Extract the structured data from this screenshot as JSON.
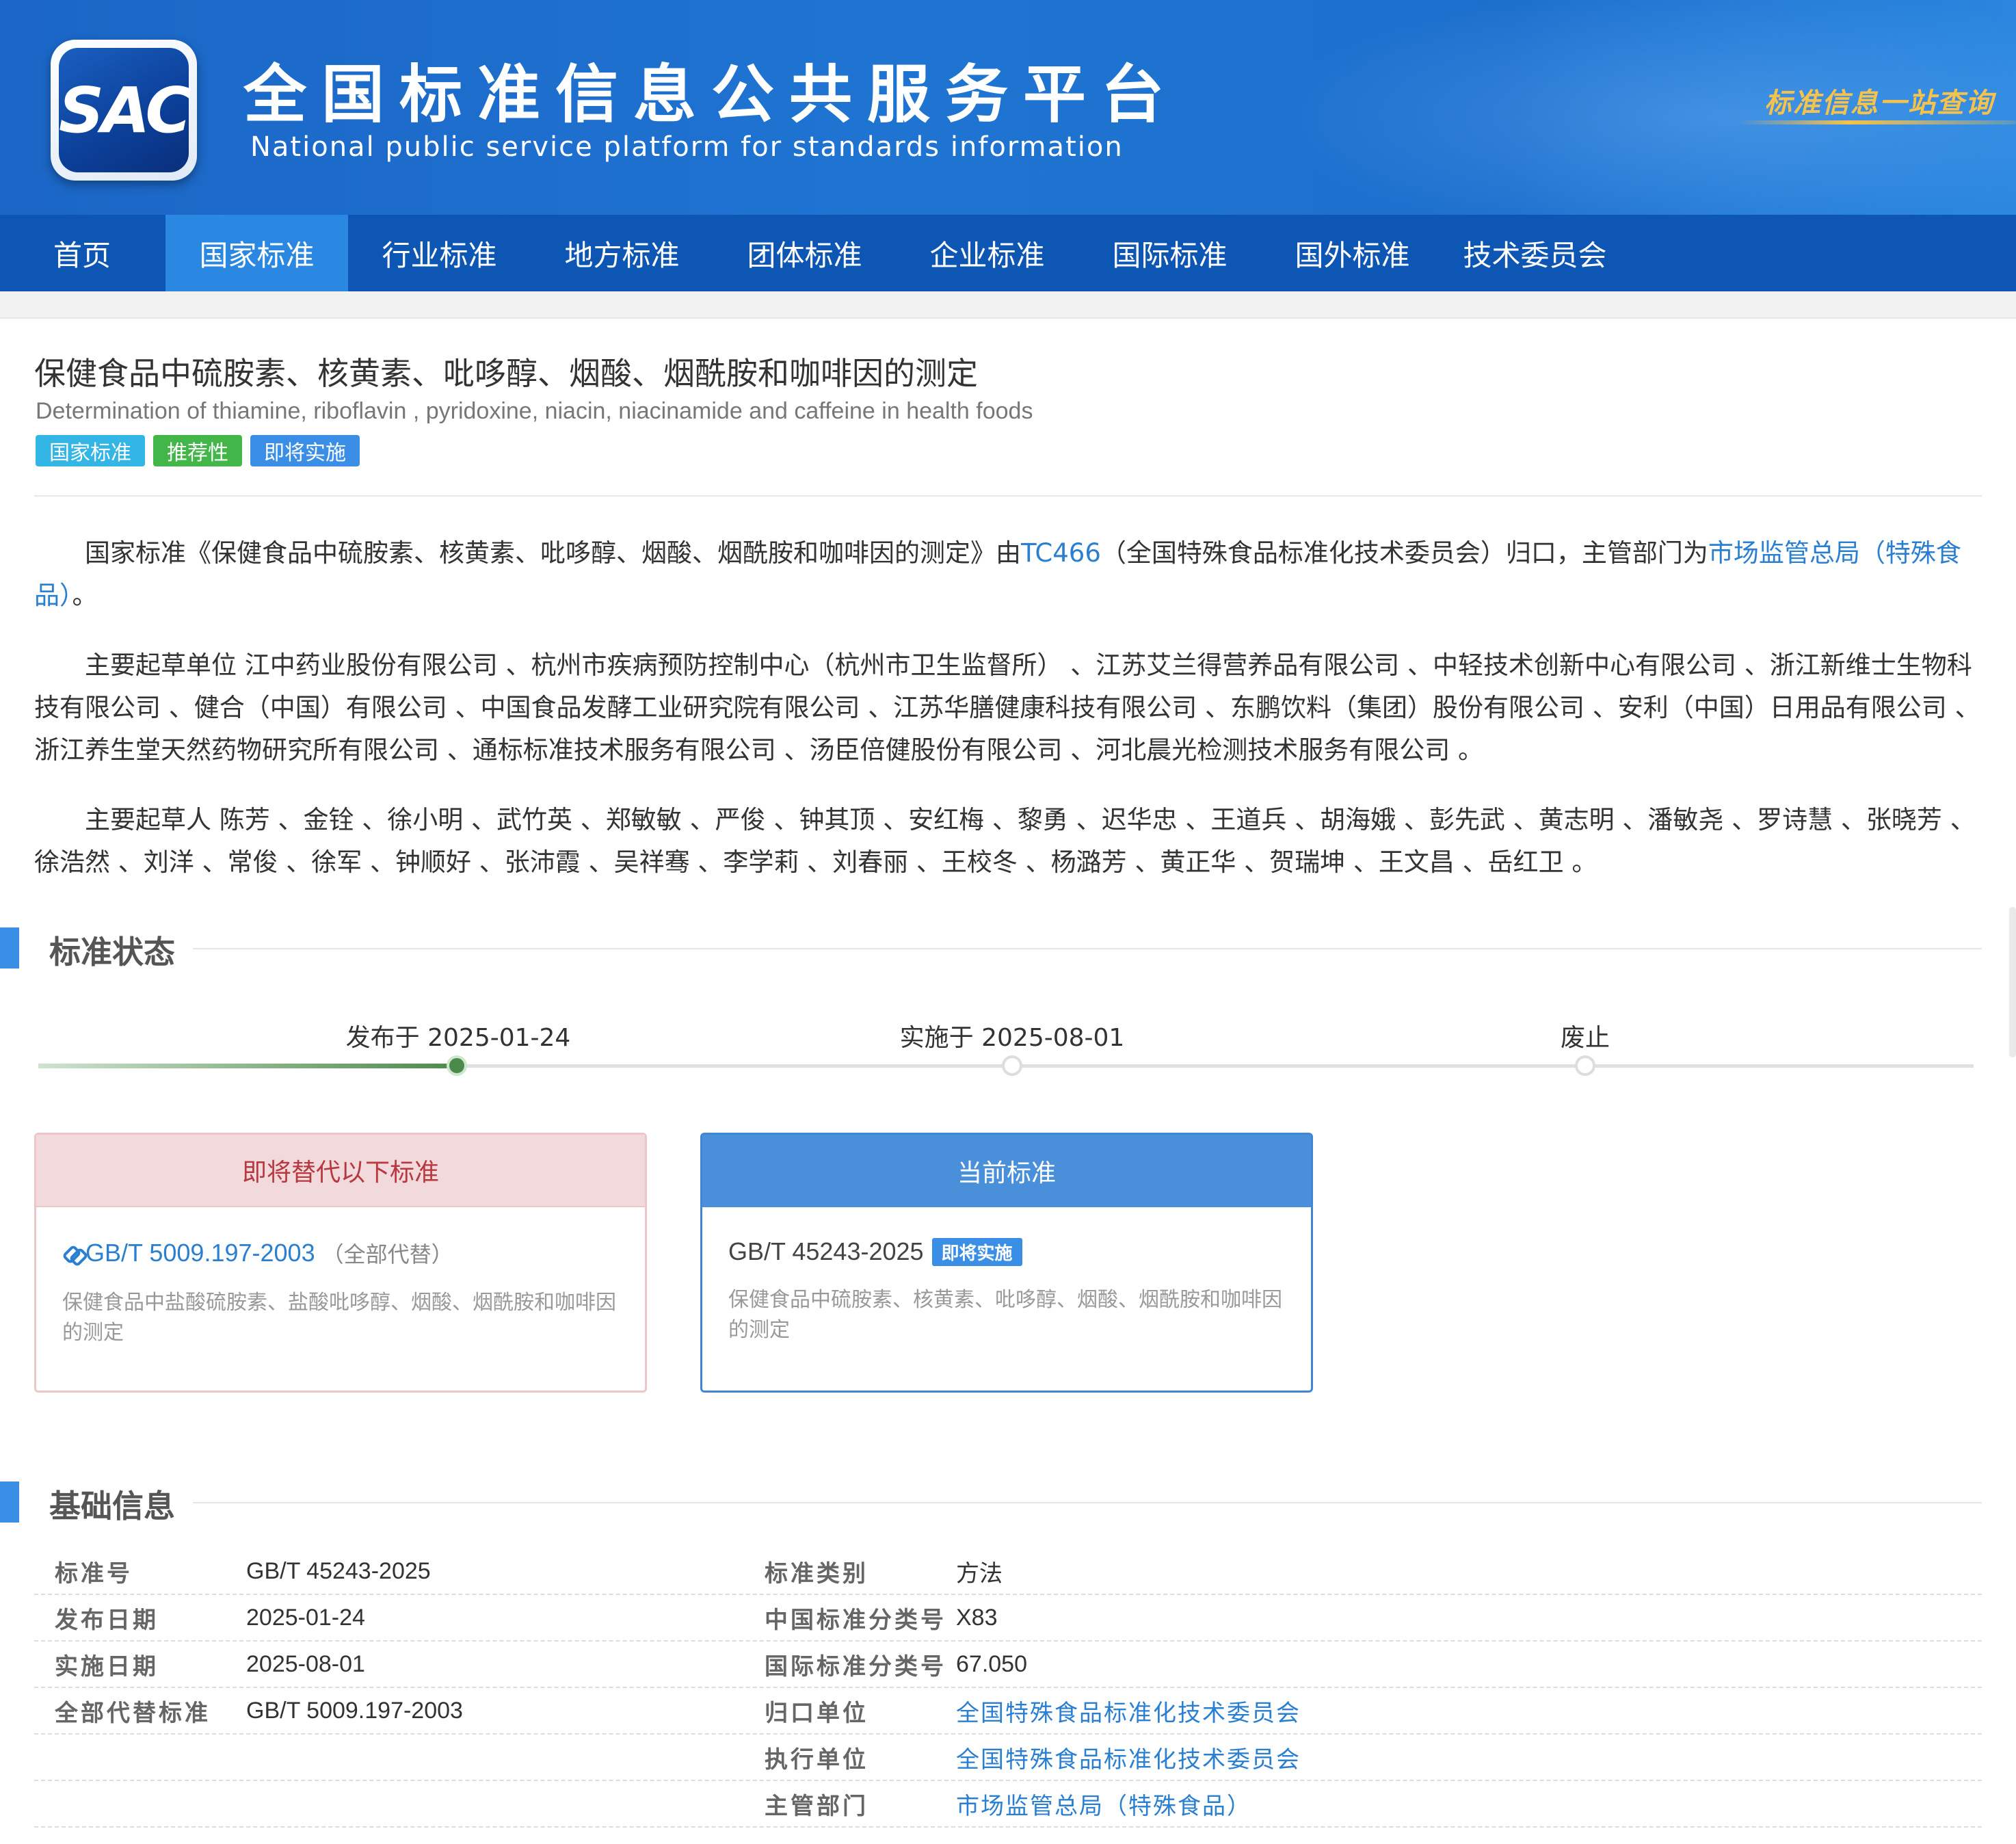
{
  "header": {
    "logo_text": "SAC",
    "title": "全国标准信息公共服务平台",
    "subtitle": "National public service platform  for standards information",
    "slogan": "标准信息一站查询"
  },
  "nav": {
    "items": [
      {
        "label": "首页"
      },
      {
        "label": "国家标准"
      },
      {
        "label": "行业标准"
      },
      {
        "label": "地方标准"
      },
      {
        "label": "团体标准"
      },
      {
        "label": "企业标准"
      },
      {
        "label": "国际标准"
      },
      {
        "label": "国外标准"
      },
      {
        "label": "技术委员会"
      }
    ],
    "active": "国家标准"
  },
  "standard": {
    "title_cn": "保健食品中硫胺素、核黄素、吡哆醇、烟酸、烟酰胺和咖啡因的测定",
    "title_en": "Determination of thiamine, riboflavin , pyridoxine, niacin, niacinamide and caffeine in health foods",
    "tags": [
      "国家标准",
      "推荐性",
      "即将实施"
    ]
  },
  "intro": {
    "p1_prefix": "国家标准《保健食品中硫胺素、核黄素、吡哆醇、烟酸、烟酰胺和咖啡因的测定》由",
    "p1_tc": "TC466",
    "p1_middle": "（全国特殊食品标准化技术委员会）归口，主管部门为",
    "p1_authority": "市场监管总局（特殊食品）",
    "p1_suffix": "。",
    "p2": "主要起草单位 江中药业股份有限公司 、杭州市疾病预防控制中心（杭州市卫生监督所） 、江苏艾兰得营养品有限公司 、中轻技术创新中心有限公司 、浙江新维士生物科技有限公司 、健合（中国）有限公司 、中国食品发酵工业研究院有限公司 、江苏华膳健康科技有限公司 、东鹏饮料（集团）股份有限公司 、安利（中国）日用品有限公司 、浙江养生堂天然药物研究所有限公司 、通标标准技术服务有限公司 、汤臣倍健股份有限公司 、河北晨光检测技术服务有限公司 。",
    "p3": "主要起草人 陈芳 、金铨 、徐小明 、武竹英 、郑敏敏 、严俊 、钟其顶 、安红梅 、黎勇 、迟华忠 、王道兵 、胡海娥 、彭先武 、黄志明 、潘敏尧 、罗诗慧 、张晓芳 、徐浩然 、刘洋 、常俊 、徐军 、钟顺好 、张沛霞 、吴祥骞 、李学莉 、刘春丽 、王校冬 、杨潞芳 、黄正华 、贺瑞坤 、王文昌 、岳红卫 。"
  },
  "status": {
    "section_title": "标准状态",
    "timeline": [
      {
        "label": "发布于 2025-01-24"
      },
      {
        "label": "实施于 2025-08-01"
      },
      {
        "label": "废止"
      }
    ],
    "replace_card": {
      "header": "即将替代以下标准",
      "code": "GB/T 5009.197-2003",
      "note": "（全部代替）",
      "desc": "保健食品中盐酸硫胺素、盐酸吡哆醇、烟酸、烟酰胺和咖啡因的测定"
    },
    "current_card": {
      "header": "当前标准",
      "code": "GB/T 45243-2025",
      "badge": "即将实施",
      "desc": "保健食品中硫胺素、核黄素、吡哆醇、烟酸、烟酰胺和咖啡因的测定"
    }
  },
  "basic": {
    "section_title": "基础信息",
    "rows": [
      {
        "l1": "标准号",
        "v1": "GB/T 45243-2025",
        "l2": "标准类别",
        "v2": "方法"
      },
      {
        "l1": "发布日期",
        "v1": "2025-01-24",
        "l2": "中国标准分类号",
        "v2": "X83"
      },
      {
        "l1": "实施日期",
        "v1": "2025-08-01",
        "l2": "国际标准分类号",
        "v2": "67.050"
      },
      {
        "l1": "全部代替标准",
        "v1": "GB/T 5009.197-2003",
        "l2": "归口单位",
        "v2": "全国特殊食品标准化技术委员会"
      },
      {
        "l1": "",
        "v1": "",
        "l2": "执行单位",
        "v2": "全国特殊食品标准化技术委员会"
      },
      {
        "l1": "",
        "v1": "",
        "l2": "主管部门",
        "v2": "市场监管总局（特殊食品）"
      }
    ]
  }
}
